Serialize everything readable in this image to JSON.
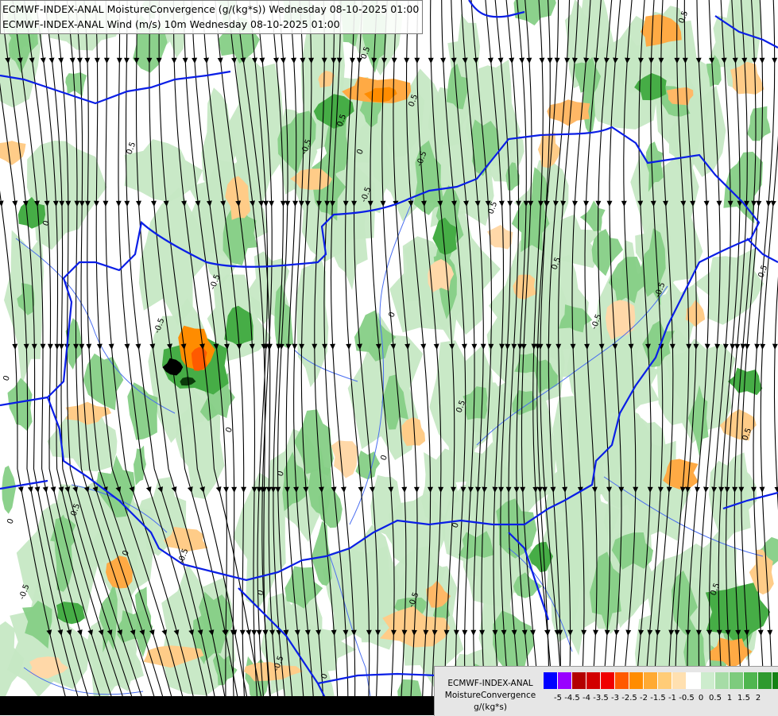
{
  "header": {
    "line1": "ECMWF-INDEX-ANAL MoistureConvergence (g/(kg*s)) Wednesday 08-10-2025 01:00",
    "line2": "ECMWF-INDEX-ANAL Wind (m/s) 10m Wednesday 08-10-2025 01:00"
  },
  "legend": {
    "line1": "ECMWF-INDEX-ANAL",
    "line2": "MoistureConvergence",
    "line3": "g/(kg*s)",
    "colors": [
      "#0000ff",
      "#9900ff",
      "#b30000",
      "#d20000",
      "#f00000",
      "#ff5a00",
      "#ff8c00",
      "#ffaa33",
      "#ffcc77",
      "#ffe0b0",
      "#ffffff",
      "#cdeccd",
      "#a6dca6",
      "#7dcb7d",
      "#4fb64f",
      "#2e9a2e",
      "#148214"
    ],
    "tick_labels": [
      "-5",
      "-4.5",
      "-4",
      "-3.5",
      "-3",
      "-2.5",
      "-2",
      "-1.5",
      "-1",
      "-0.5",
      "0",
      "0.5",
      "1",
      "1.5",
      "2"
    ]
  },
  "map": {
    "contour_labels": [
      "0.5",
      "0.5",
      "-0.5",
      "0",
      "0",
      "-0.5",
      "0.5",
      "0",
      "-0.5",
      "0",
      "0.5",
      "0",
      "-0.5",
      "0",
      "0.5",
      "-0.5",
      "0.5",
      "0",
      "0.5",
      "-0.5",
      "0",
      "0.5",
      "-0.5",
      "-0.5",
      "0",
      "0.5",
      "0",
      "-0.5",
      "0",
      "0.5",
      "-0.5",
      "0.5",
      "-0.5",
      "0",
      "0.5"
    ],
    "colors": {
      "border": "#0a1ee6",
      "river": "#4a6ef0",
      "streamline": "#000000"
    }
  }
}
